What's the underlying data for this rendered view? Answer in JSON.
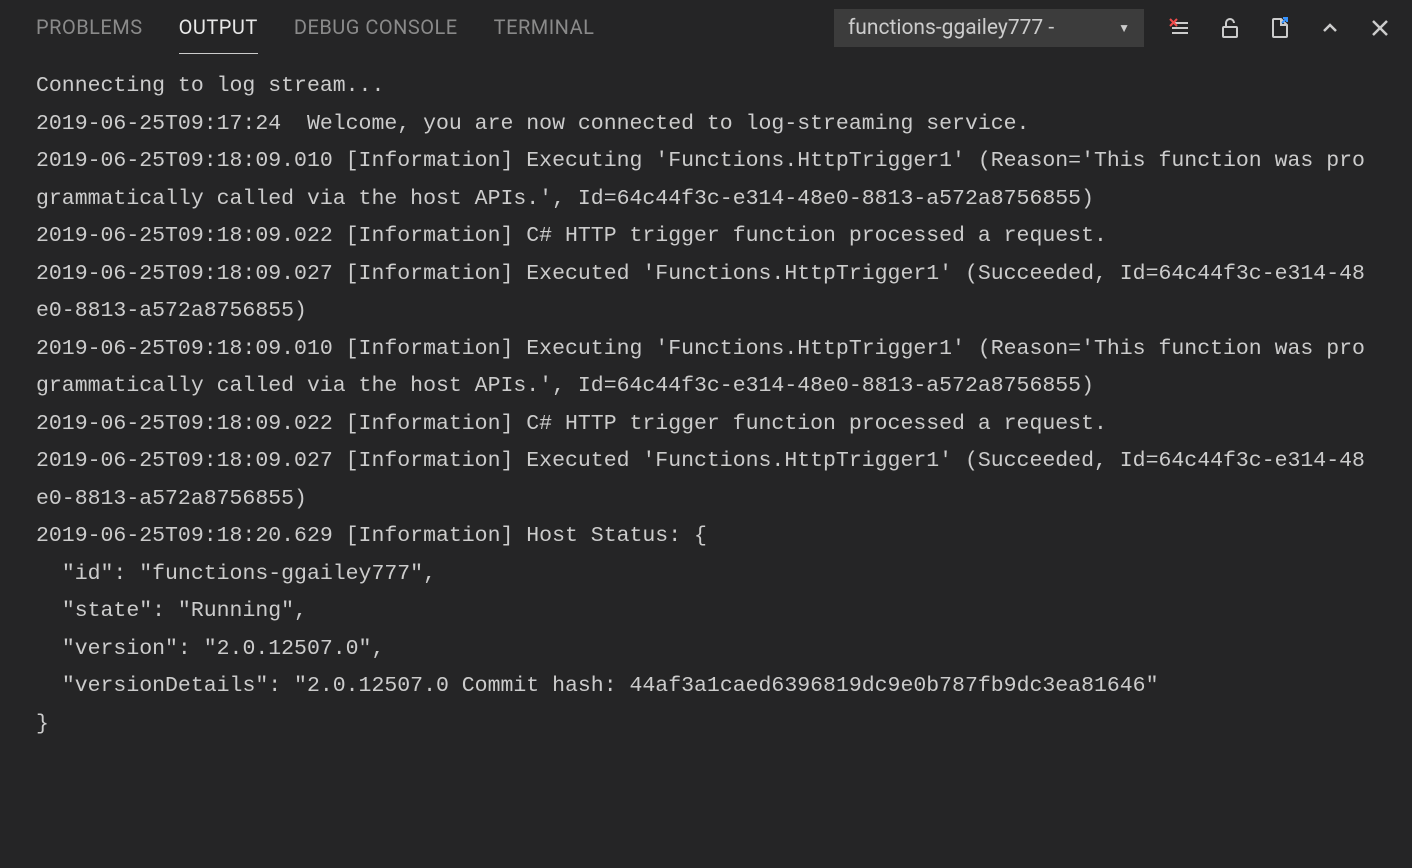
{
  "tabs": {
    "problems": "PROBLEMS",
    "output": "OUTPUT",
    "debug_console": "DEBUG CONSOLE",
    "terminal": "TERMINAL"
  },
  "dropdown": {
    "selected": "functions-ggailey777 -"
  },
  "log_lines": [
    "Connecting to log stream...",
    "2019-06-25T09:17:24  Welcome, you are now connected to log-streaming service.",
    "2019-06-25T09:18:09.010 [Information] Executing 'Functions.HttpTrigger1' (Reason='This function was programmatically called via the host APIs.', Id=64c44f3c-e314-48e0-8813-a572a8756855)",
    "2019-06-25T09:18:09.022 [Information] C# HTTP trigger function processed a request.",
    "2019-06-25T09:18:09.027 [Information] Executed 'Functions.HttpTrigger1' (Succeeded, Id=64c44f3c-e314-48e0-8813-a572a8756855)",
    "2019-06-25T09:18:09.010 [Information] Executing 'Functions.HttpTrigger1' (Reason='This function was programmatically called via the host APIs.', Id=64c44f3c-e314-48e0-8813-a572a8756855)",
    "2019-06-25T09:18:09.022 [Information] C# HTTP trigger function processed a request.",
    "2019-06-25T09:18:09.027 [Information] Executed 'Functions.HttpTrigger1' (Succeeded, Id=64c44f3c-e314-48e0-8813-a572a8756855)",
    "2019-06-25T09:18:20.629 [Information] Host Status: {",
    "  \"id\": \"functions-ggailey777\",",
    "  \"state\": \"Running\",",
    "  \"version\": \"2.0.12507.0\",",
    "  \"versionDetails\": \"2.0.12507.0 Commit hash: 44af3a1caed6396819dc9e0b787fb9dc3ea81646\"",
    "}"
  ]
}
